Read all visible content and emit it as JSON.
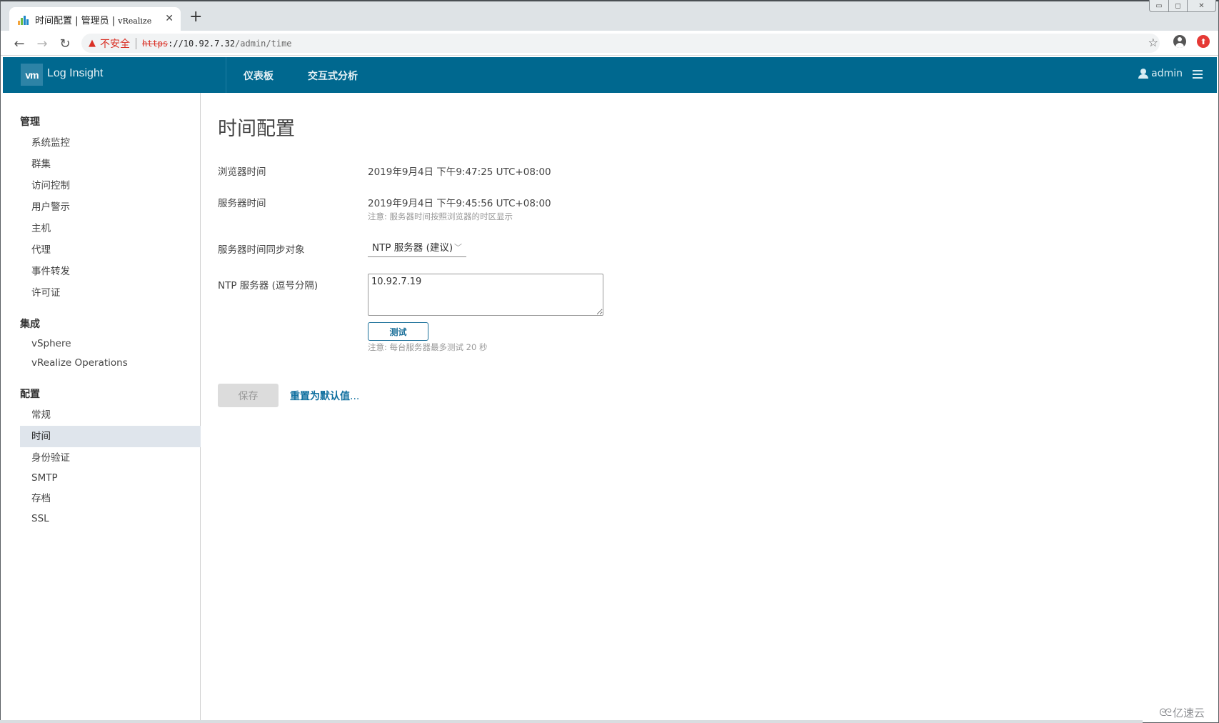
{
  "browser": {
    "tab": {
      "title_cn": "时间配置 | 管理员 | ",
      "title_latin": "vRealize"
    },
    "url": {
      "security_label": "不安全",
      "scheme": "https",
      "host": "://10.92.7.32",
      "path": "/admin/time"
    }
  },
  "header": {
    "logo": "vm",
    "app_name": "Log Insight",
    "nav": [
      {
        "label": "仪表板"
      },
      {
        "label": "交互式分析"
      }
    ],
    "user": "admin"
  },
  "sidebar": {
    "sections": [
      {
        "title": "管理",
        "items": [
          {
            "label": "系统监控"
          },
          {
            "label": "群集"
          },
          {
            "label": "访问控制"
          },
          {
            "label": "用户警示"
          },
          {
            "label": "主机"
          },
          {
            "label": "代理"
          },
          {
            "label": "事件转发"
          },
          {
            "label": "许可证"
          }
        ]
      },
      {
        "title": "集成",
        "items": [
          {
            "label": "vSphere"
          },
          {
            "label": "vRealize Operations"
          }
        ]
      },
      {
        "title": "配置",
        "items": [
          {
            "label": "常规"
          },
          {
            "label": "时间",
            "active": true
          },
          {
            "label": "身份验证"
          },
          {
            "label": "SMTP"
          },
          {
            "label": "存档"
          },
          {
            "label": "SSL"
          }
        ]
      }
    ]
  },
  "main": {
    "title": "时间配置",
    "browser_time_label": "浏览器时间",
    "browser_time_value": "2019年9月4日 下午9:47:25 UTC+08:00",
    "server_time_label": "服务器时间",
    "server_time_value": "2019年9月4日 下午9:45:56 UTC+08:00",
    "server_time_note": "注意: 服务器时间按照浏览器的时区显示",
    "sync_label": "服务器时间同步对象",
    "sync_selected": "NTP 服务器 (建议)",
    "ntp_label": "NTP 服务器 (逗号分隔)",
    "ntp_value": "10.92.7.19",
    "test_button": "测试",
    "test_note": "注意: 每台服务器最多测试 20 秒",
    "save_button": "保存",
    "reset_link": "重置为默认值",
    "reset_ellipsis": "..."
  },
  "watermark": "亿速云"
}
